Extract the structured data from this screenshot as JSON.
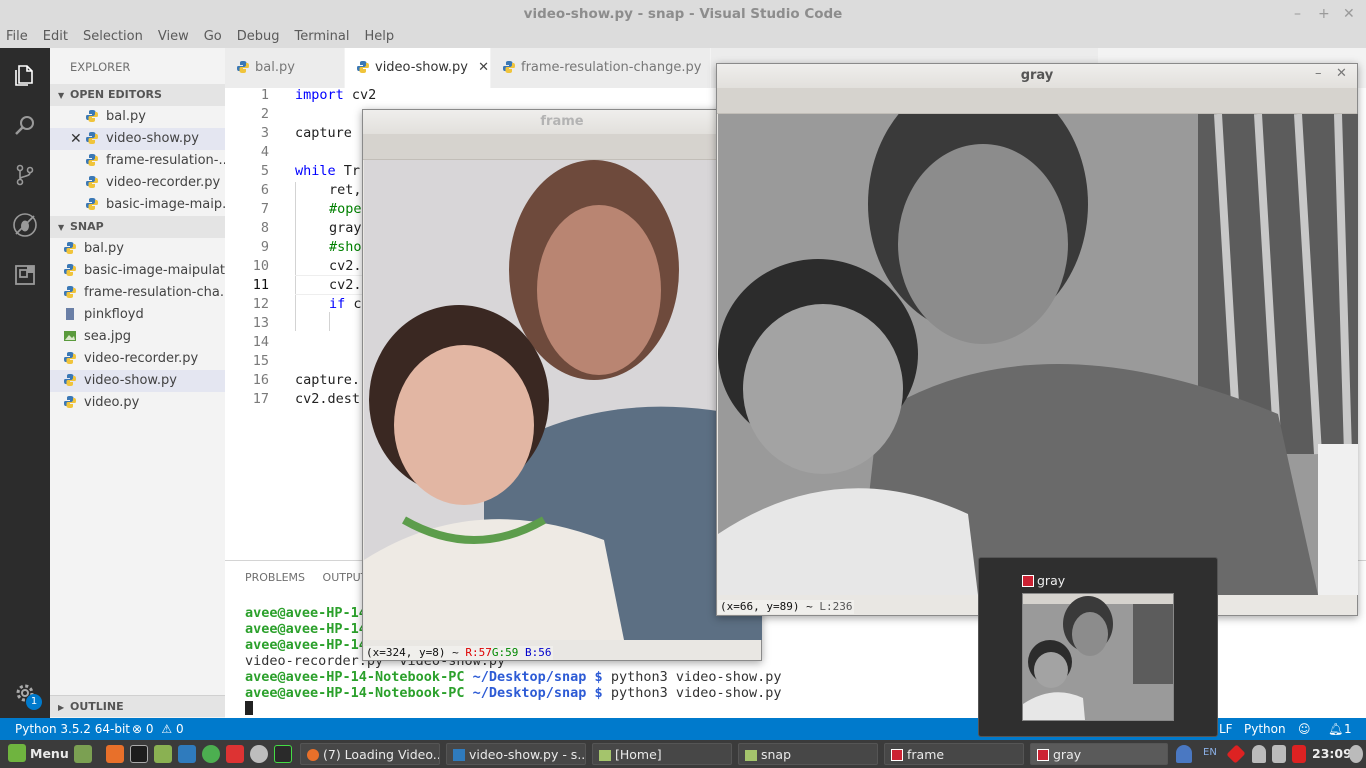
{
  "window": {
    "title": "video-show.py - snap - Visual Studio Code"
  },
  "menu": [
    "File",
    "Edit",
    "Selection",
    "View",
    "Go",
    "Debug",
    "Terminal",
    "Help"
  ],
  "sidebar": {
    "title": "EXPLORER",
    "open_editors": {
      "label": "OPEN EDITORS",
      "items": [
        "bal.py",
        "video-show.py",
        "frame-resulation-...",
        "video-recorder.py",
        "basic-image-maip..."
      ]
    },
    "snap": {
      "label": "SNAP",
      "items": [
        "bal.py",
        "basic-image-maipulat...",
        "frame-resulation-cha...",
        "pinkfloyd",
        "sea.jpg",
        "video-recorder.py",
        "video-show.py",
        "video.py"
      ]
    },
    "outline": "OUTLINE",
    "settings_badge": "1"
  },
  "tabs": [
    "bal.py",
    "video-show.py",
    "frame-resulation-change.py"
  ],
  "editor": {
    "line_numbers": [
      "1",
      "2",
      "3",
      "4",
      "5",
      "6",
      "7",
      "8",
      "9",
      "10",
      "11",
      "12",
      "13",
      "14",
      "15",
      "16",
      "17"
    ],
    "lines": {
      "l1a": "import",
      "l1b": " cv2",
      "l3": "capture",
      "l5a": "while",
      "l5b": " Tr",
      "l6": "ret,",
      "l7": "#ope",
      "l8": "gray",
      "l9": "#sho",
      "l10": "cv2.",
      "l11": "cv2.",
      "l12a": "if",
      "l12b": " c",
      "l16": "capture.",
      "l17": "cv2.dest"
    }
  },
  "panel": {
    "tabs": [
      "PROBLEMS",
      "OUTPUT"
    ],
    "terminal": {
      "user_host": "avee@avee-HP-14-Notebook-PC",
      "user_host_cut": "avee@avee-HP-14",
      "path": "~/Desktop/snap",
      "prompt": "$",
      "listing": "video-recorder.py  video-show.py",
      "command": "python3 video-show.py"
    }
  },
  "statusbar": {
    "python": "Python 3.5.2 64-bit",
    "errors": "0",
    "warnings": "0",
    "eol": "LF",
    "language": "Python",
    "notifications": "1"
  },
  "cv_frame": {
    "title": "frame",
    "status_pos": "(x=324, y=8) ~",
    "r": "R:57",
    "g": "G:59",
    "b": "B:56"
  },
  "cv_gray": {
    "title": "gray",
    "status_pos": "(x=66, y=89) ~",
    "l": "L:236"
  },
  "preview": {
    "title": "gray"
  },
  "taskbar": {
    "menu": "Menu",
    "items": [
      "(7) Loading Video...",
      "video-show.py - s...",
      "[Home]",
      "snap",
      "frame",
      "gray"
    ],
    "lang": "EN",
    "clock": "23:09"
  },
  "colors": {
    "status_blue": "#007acc",
    "terminal_green": "#2ba02b",
    "terminal_blue": "#2d5bd5",
    "keyword_blue": "#0000ff",
    "comment_green": "#008000"
  }
}
